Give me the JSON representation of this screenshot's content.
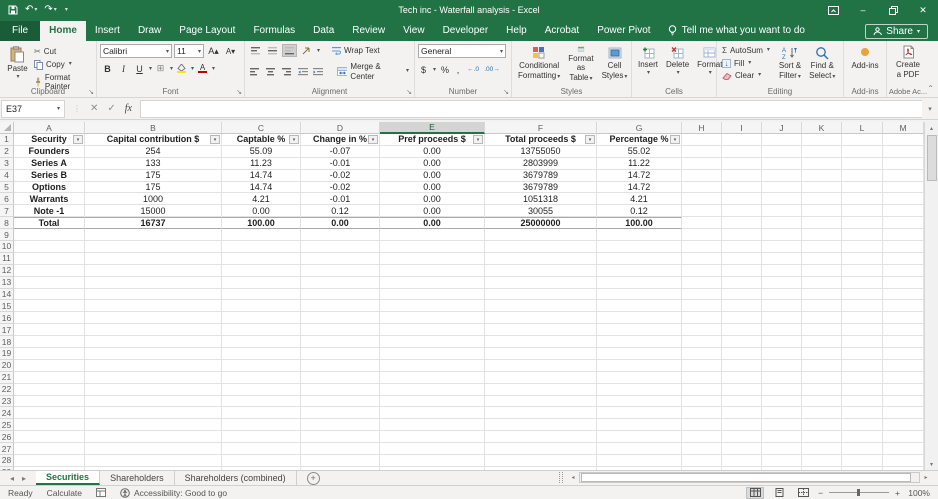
{
  "window": {
    "title": "Tech inc - Waterfall analysis - Excel",
    "share_label": "Share"
  },
  "menu_tabs": {
    "items": [
      "File",
      "Home",
      "Insert",
      "Draw",
      "Page Layout",
      "Formulas",
      "Data",
      "Review",
      "View",
      "Developer",
      "Help",
      "Acrobat",
      "Power Pivot"
    ],
    "active": "Home",
    "tell_me": "Tell me what you want to do"
  },
  "ribbon": {
    "clipboard": {
      "group": "Clipboard",
      "paste": "Paste",
      "cut": "Cut",
      "copy": "Copy",
      "format_painter": "Format Painter"
    },
    "font": {
      "group": "Font",
      "name": "Calibri",
      "size": "11",
      "bold": "B",
      "italic": "I",
      "underline": "U"
    },
    "alignment": {
      "group": "Alignment",
      "wrap": "Wrap Text",
      "merge": "Merge & Center"
    },
    "number": {
      "group": "Number",
      "format": "General",
      "currency": "$",
      "percent": "%",
      "comma": ",",
      "inc_dec": "←.0",
      "dec_dec": ".00→"
    },
    "styles": {
      "group": "Styles",
      "conditional_1": "Conditional",
      "conditional_2": "Formatting",
      "table_1": "Format as",
      "table_2": "Table",
      "cellstyles_1": "Cell",
      "cellstyles_2": "Styles"
    },
    "cells": {
      "group": "Cells",
      "insert": "Insert",
      "delete": "Delete",
      "format": "Format"
    },
    "editing": {
      "group": "Editing",
      "autosum": "AutoSum",
      "fill": "Fill",
      "clear": "Clear",
      "sort_1": "Sort &",
      "sort_2": "Filter",
      "find_1": "Find &",
      "find_2": "Select"
    },
    "addins": {
      "group": "Add-ins",
      "addins": "Add-ins"
    },
    "adobe": {
      "group": "Adobe Ac...",
      "create_1": "Create",
      "create_2": "a PDF"
    }
  },
  "formula_bar": {
    "name_box": "E37",
    "formula": ""
  },
  "grid": {
    "columns": [
      "A",
      "B",
      "C",
      "D",
      "E",
      "F",
      "G",
      "H",
      "I",
      "J",
      "K",
      "L",
      "M"
    ],
    "selected_column": "E",
    "visible_rows": 29,
    "table": {
      "headers": [
        "Security",
        "Capital contribution $",
        "Captable %",
        "Change in %",
        "Pref proceeds $",
        "Total proceeds $",
        "Percentage %"
      ],
      "rows": [
        [
          "Founders",
          "254",
          "55.09",
          "-0.07",
          "0.00",
          "13755050",
          "55.02"
        ],
        [
          "Series A",
          "133",
          "11.23",
          "-0.01",
          "0.00",
          "2803999",
          "11.22"
        ],
        [
          "Series B",
          "175",
          "14.74",
          "-0.02",
          "0.00",
          "3679789",
          "14.72"
        ],
        [
          "Options",
          "175",
          "14.74",
          "-0.02",
          "0.00",
          "3679789",
          "14.72"
        ],
        [
          "Warrants",
          "1000",
          "4.21",
          "-0.01",
          "0.00",
          "1051318",
          "4.21"
        ],
        [
          "Note -1",
          "15000",
          "0.00",
          "0.12",
          "0.00",
          "30055",
          "0.12"
        ],
        [
          "Total",
          "16737",
          "100.00",
          "0.00",
          "0.00",
          "25000000",
          "100.00"
        ]
      ]
    }
  },
  "sheet_tabs": {
    "items": [
      "Securities",
      "Shareholders",
      "Shareholders (combined)"
    ],
    "active": "Securities"
  },
  "status_bar": {
    "mode": "Ready",
    "calculate": "Calculate",
    "accessibility": "Accessibility: Good to go",
    "zoom_level": "100%"
  },
  "colors": {
    "excel_green": "#217346",
    "addin_orange": "#e8a33d",
    "fill_yellow": "#ffe600",
    "font_red": "#c00000"
  },
  "icons": {
    "undo": "↶",
    "redo": "↷",
    "dropdown": "▾",
    "minimize": "–",
    "close": "✕",
    "cut": "✂",
    "sigma": "Σ",
    "cancel": "✕",
    "enter": "✓",
    "fx": "fx",
    "up_arrow": "▴",
    "down_arrow": "▾",
    "left_arrow": "◂",
    "right_arrow": "▸",
    "border_grid": "⊞",
    "launcher": "↘",
    "collapse_ribbon": "⌃",
    "plus": "+",
    "minus": "−",
    "fill_down": "↓",
    "a_up": "A▴",
    "a_down": "A▾"
  }
}
